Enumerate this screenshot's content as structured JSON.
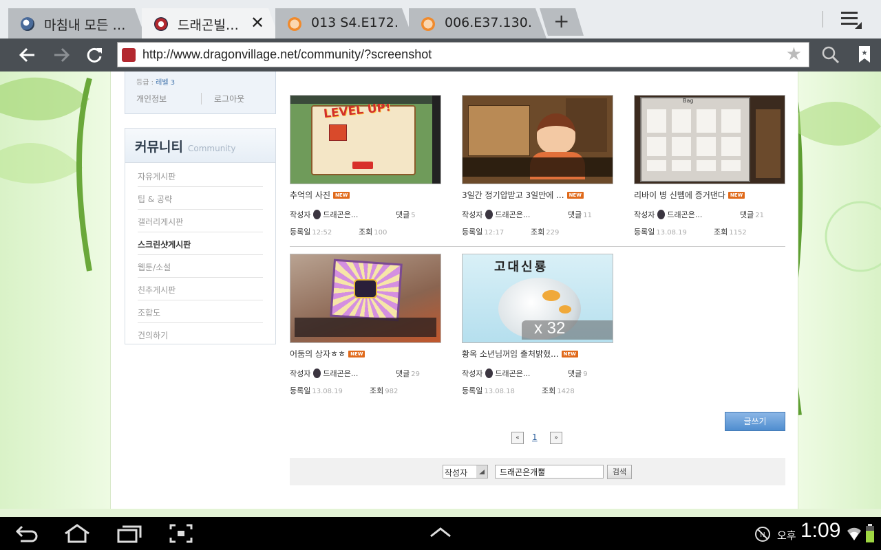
{
  "browser": {
    "tabs": [
      {
        "title": "마침내 모든 …",
        "active": false
      },
      {
        "title": "드래곤빌…",
        "active": true
      },
      {
        "title": "013 S4.E172…",
        "active": false
      },
      {
        "title": "006.E37.130…",
        "active": false
      }
    ],
    "new_tab_label": "+",
    "close_label": "✕",
    "url": "http://www.dragonvillage.net/community/?screenshot"
  },
  "profile": {
    "grade_label": "등급 :",
    "grade_value": "레벨 3",
    "links": [
      "개인정보",
      "로그아웃"
    ]
  },
  "sidebar": {
    "title_ko": "커뮤니티",
    "title_en": "Community",
    "items": [
      {
        "label": "자유게시판",
        "active": false
      },
      {
        "label": "팁 & 공략",
        "active": false
      },
      {
        "label": "갤러리게시판",
        "active": false
      },
      {
        "label": "스크린샷게시판",
        "active": true
      },
      {
        "label": "웹툰/소설",
        "active": false
      },
      {
        "label": "친추게시판",
        "active": false
      },
      {
        "label": "조합도",
        "active": false
      },
      {
        "label": "건의하기",
        "active": false
      }
    ]
  },
  "labels": {
    "author": "작성자",
    "comments": "댓글",
    "date": "등록일",
    "views": "조회",
    "new_badge": "NEW"
  },
  "posts": [
    {
      "title": "추억의 사진",
      "author": "드래곤은...",
      "comments": "5",
      "date": "12:52",
      "views": "100",
      "thumb_text": "LEVEL UP!"
    },
    {
      "title": "3일간 정기압받고 3일만에 ...",
      "author": "드래곤은...",
      "comments": "11",
      "date": "12:17",
      "views": "229",
      "thumb_text": ""
    },
    {
      "title": "리바이 병 신뗌에 증거댄다",
      "author": "드래곤은...",
      "comments": "21",
      "date": "13.08.19",
      "views": "1152",
      "thumb_text": "Bag"
    },
    {
      "title": "어둠의 상자ㅎㅎ",
      "author": "드래곤은...",
      "comments": "29",
      "date": "13.08.19",
      "views": "982",
      "thumb_text": ""
    },
    {
      "title": "황옥 소년님꺼임 출처밝혔...",
      "author": "드래곤은...",
      "comments": "9",
      "date": "13.08.18",
      "views": "1428",
      "thumb_text": "고대신룡"
    }
  ],
  "thumb_extra": {
    "egg_count": "x 32"
  },
  "write_button": "글쓰기",
  "pager": {
    "first": "«",
    "current": "1",
    "last": "»"
  },
  "search": {
    "field_option": "작성자",
    "keyword": "드래곤은개뿔",
    "button": "검색"
  },
  "status": {
    "ampm": "오후",
    "time": "1:09"
  }
}
